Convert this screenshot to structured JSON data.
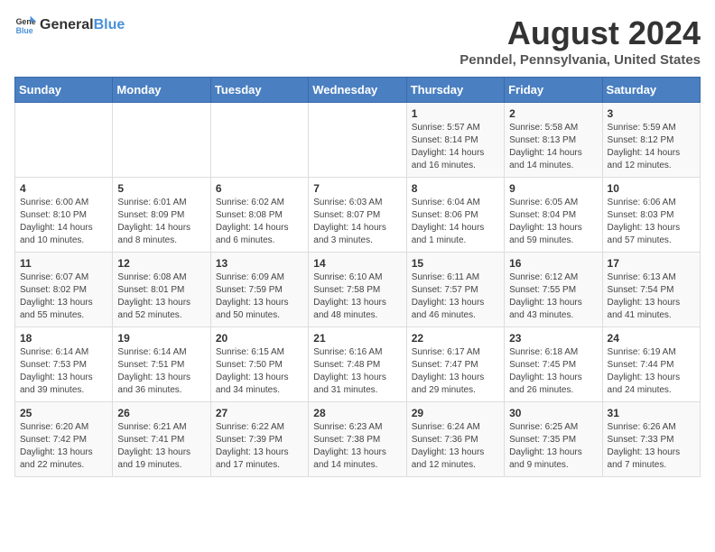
{
  "header": {
    "logo_general": "General",
    "logo_blue": "Blue",
    "title": "August 2024",
    "subtitle": "Penndel, Pennsylvania, United States"
  },
  "weekdays": [
    "Sunday",
    "Monday",
    "Tuesday",
    "Wednesday",
    "Thursday",
    "Friday",
    "Saturday"
  ],
  "weeks": [
    [
      {
        "day": "",
        "info": ""
      },
      {
        "day": "",
        "info": ""
      },
      {
        "day": "",
        "info": ""
      },
      {
        "day": "",
        "info": ""
      },
      {
        "day": "1",
        "info": "Sunrise: 5:57 AM\nSunset: 8:14 PM\nDaylight: 14 hours\nand 16 minutes."
      },
      {
        "day": "2",
        "info": "Sunrise: 5:58 AM\nSunset: 8:13 PM\nDaylight: 14 hours\nand 14 minutes."
      },
      {
        "day": "3",
        "info": "Sunrise: 5:59 AM\nSunset: 8:12 PM\nDaylight: 14 hours\nand 12 minutes."
      }
    ],
    [
      {
        "day": "4",
        "info": "Sunrise: 6:00 AM\nSunset: 8:10 PM\nDaylight: 14 hours\nand 10 minutes."
      },
      {
        "day": "5",
        "info": "Sunrise: 6:01 AM\nSunset: 8:09 PM\nDaylight: 14 hours\nand 8 minutes."
      },
      {
        "day": "6",
        "info": "Sunrise: 6:02 AM\nSunset: 8:08 PM\nDaylight: 14 hours\nand 6 minutes."
      },
      {
        "day": "7",
        "info": "Sunrise: 6:03 AM\nSunset: 8:07 PM\nDaylight: 14 hours\nand 3 minutes."
      },
      {
        "day": "8",
        "info": "Sunrise: 6:04 AM\nSunset: 8:06 PM\nDaylight: 14 hours\nand 1 minute."
      },
      {
        "day": "9",
        "info": "Sunrise: 6:05 AM\nSunset: 8:04 PM\nDaylight: 13 hours\nand 59 minutes."
      },
      {
        "day": "10",
        "info": "Sunrise: 6:06 AM\nSunset: 8:03 PM\nDaylight: 13 hours\nand 57 minutes."
      }
    ],
    [
      {
        "day": "11",
        "info": "Sunrise: 6:07 AM\nSunset: 8:02 PM\nDaylight: 13 hours\nand 55 minutes."
      },
      {
        "day": "12",
        "info": "Sunrise: 6:08 AM\nSunset: 8:01 PM\nDaylight: 13 hours\nand 52 minutes."
      },
      {
        "day": "13",
        "info": "Sunrise: 6:09 AM\nSunset: 7:59 PM\nDaylight: 13 hours\nand 50 minutes."
      },
      {
        "day": "14",
        "info": "Sunrise: 6:10 AM\nSunset: 7:58 PM\nDaylight: 13 hours\nand 48 minutes."
      },
      {
        "day": "15",
        "info": "Sunrise: 6:11 AM\nSunset: 7:57 PM\nDaylight: 13 hours\nand 46 minutes."
      },
      {
        "day": "16",
        "info": "Sunrise: 6:12 AM\nSunset: 7:55 PM\nDaylight: 13 hours\nand 43 minutes."
      },
      {
        "day": "17",
        "info": "Sunrise: 6:13 AM\nSunset: 7:54 PM\nDaylight: 13 hours\nand 41 minutes."
      }
    ],
    [
      {
        "day": "18",
        "info": "Sunrise: 6:14 AM\nSunset: 7:53 PM\nDaylight: 13 hours\nand 39 minutes."
      },
      {
        "day": "19",
        "info": "Sunrise: 6:14 AM\nSunset: 7:51 PM\nDaylight: 13 hours\nand 36 minutes."
      },
      {
        "day": "20",
        "info": "Sunrise: 6:15 AM\nSunset: 7:50 PM\nDaylight: 13 hours\nand 34 minutes."
      },
      {
        "day": "21",
        "info": "Sunrise: 6:16 AM\nSunset: 7:48 PM\nDaylight: 13 hours\nand 31 minutes."
      },
      {
        "day": "22",
        "info": "Sunrise: 6:17 AM\nSunset: 7:47 PM\nDaylight: 13 hours\nand 29 minutes."
      },
      {
        "day": "23",
        "info": "Sunrise: 6:18 AM\nSunset: 7:45 PM\nDaylight: 13 hours\nand 26 minutes."
      },
      {
        "day": "24",
        "info": "Sunrise: 6:19 AM\nSunset: 7:44 PM\nDaylight: 13 hours\nand 24 minutes."
      }
    ],
    [
      {
        "day": "25",
        "info": "Sunrise: 6:20 AM\nSunset: 7:42 PM\nDaylight: 13 hours\nand 22 minutes."
      },
      {
        "day": "26",
        "info": "Sunrise: 6:21 AM\nSunset: 7:41 PM\nDaylight: 13 hours\nand 19 minutes."
      },
      {
        "day": "27",
        "info": "Sunrise: 6:22 AM\nSunset: 7:39 PM\nDaylight: 13 hours\nand 17 minutes."
      },
      {
        "day": "28",
        "info": "Sunrise: 6:23 AM\nSunset: 7:38 PM\nDaylight: 13 hours\nand 14 minutes."
      },
      {
        "day": "29",
        "info": "Sunrise: 6:24 AM\nSunset: 7:36 PM\nDaylight: 13 hours\nand 12 minutes."
      },
      {
        "day": "30",
        "info": "Sunrise: 6:25 AM\nSunset: 7:35 PM\nDaylight: 13 hours\nand 9 minutes."
      },
      {
        "day": "31",
        "info": "Sunrise: 6:26 AM\nSunset: 7:33 PM\nDaylight: 13 hours\nand 7 minutes."
      }
    ]
  ]
}
